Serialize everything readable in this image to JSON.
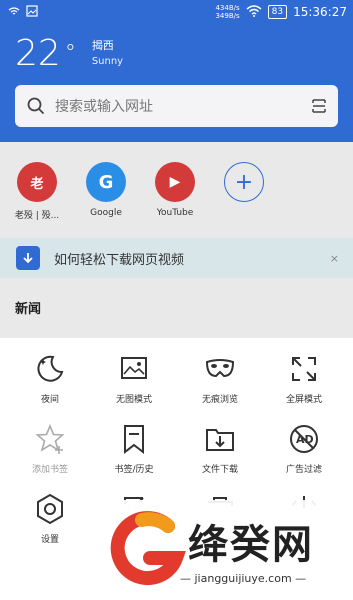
{
  "status": {
    "speed_up": "434B/s",
    "speed_down": "349B/s",
    "battery": "83",
    "time": "15:36:27"
  },
  "weather": {
    "temp": "22",
    "unit": "°",
    "city": "揭西",
    "condition": "Sunny"
  },
  "search": {
    "placeholder": "搜索或输入网址"
  },
  "shortcuts": [
    {
      "label": "老殁 | 殁...",
      "glyph": "老",
      "color": "#d33a3a"
    },
    {
      "label": "Google",
      "glyph": "G",
      "color": "#2a8ee6"
    },
    {
      "label": "YouTube",
      "glyph": "▶",
      "color": "#d33a3a"
    },
    {
      "label": "",
      "glyph": "+",
      "color": "#2f6bd3"
    }
  ],
  "banner": {
    "text": "如何轻松下载网页视频",
    "close": "×"
  },
  "news": {
    "title": "新闻"
  },
  "menu": [
    {
      "label": "夜间",
      "icon": "moon-icon"
    },
    {
      "label": "无图模式",
      "icon": "image-off-icon"
    },
    {
      "label": "无痕浏览",
      "icon": "mask-icon"
    },
    {
      "label": "全屏模式",
      "icon": "fullscreen-icon"
    },
    {
      "label": "添加书签",
      "icon": "star-add-icon"
    },
    {
      "label": "书签/历史",
      "icon": "bookmark-icon"
    },
    {
      "label": "文件下载",
      "icon": "download-folder-icon"
    },
    {
      "label": "广告过滤",
      "icon": "ad-block-icon"
    },
    {
      "label": "设置",
      "icon": "settings-icon"
    }
  ],
  "watermark": {
    "title": "绛癸网",
    "site": "— jiangguijiuye.com —"
  }
}
